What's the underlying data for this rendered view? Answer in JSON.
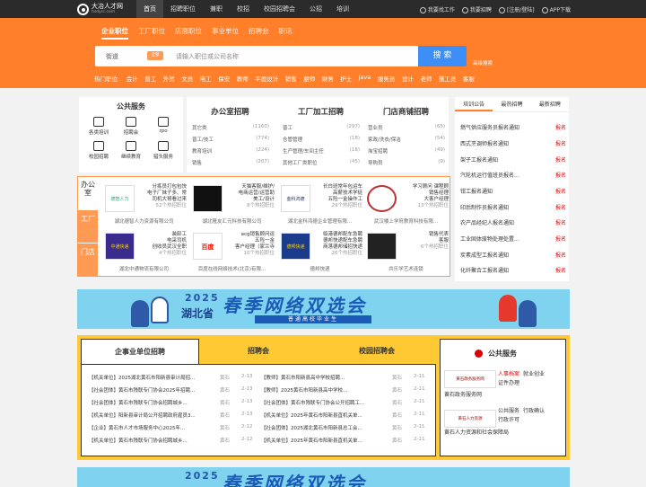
{
  "brand": {
    "name": "大冶人才网",
    "sub": "hsdyrc.com"
  },
  "topnav": [
    "首页",
    "招聘职位",
    "兼职",
    "校招",
    "校园招聘会",
    "公招",
    "培训"
  ],
  "topright": [
    "我要找工作",
    "我要招聘",
    "[注册/登陆]",
    "APP下载"
  ],
  "search": {
    "tabs": [
      "企业职位",
      "工厂职位",
      "店面职位",
      "事业单位",
      "招聘会",
      "职讯"
    ],
    "city": "街道",
    "tag": "全部",
    "placeholder": "请输入职位或公司名称",
    "button": "搜 索",
    "advanced": "高级搜索"
  },
  "hot": {
    "label": "热门职位:",
    "items": [
      "会计",
      "普工",
      "外贸",
      "文员",
      "电工",
      "保安",
      "教师",
      "平面设计",
      "销售",
      "厨师",
      "财务",
      "护士",
      "java",
      "服务员",
      "设计",
      "老师",
      "施工员",
      "客服"
    ]
  },
  "services": {
    "title": "公共服务",
    "items": [
      "各类培训",
      "招聘会",
      "rpo",
      "校园招聘",
      "继续教育",
      "猎头服务"
    ]
  },
  "categories": [
    {
      "title": "办公室招聘",
      "rows": [
        [
          "其它类",
          "(1160)"
        ],
        [
          "普工/技工",
          "(774)"
        ],
        [
          "教育培训",
          "(224)"
        ],
        [
          "销售",
          "(207)"
        ]
      ]
    },
    {
      "title": "工厂加工招聘",
      "rows": [
        [
          "普工",
          "(297)"
        ],
        [
          "仓管管理",
          "(18)"
        ],
        [
          "生产管理/车间主任",
          "(18)"
        ],
        [
          "其他工厂类职位",
          "(45)"
        ]
      ]
    },
    {
      "title": "门店商铺招聘",
      "rows": [
        [
          "营业员",
          "(65)"
        ],
        [
          "家政/洗衣/保洁",
          "(54)"
        ],
        [
          "淘宝招聘",
          "(49)"
        ],
        [
          "导购员",
          "(9)"
        ]
      ]
    }
  ],
  "notice": {
    "tabs": [
      "培训公告",
      "最热招聘",
      "最新招聘"
    ],
    "rows": [
      [
        "燃气供应服务员报名通知",
        "报名"
      ],
      [
        "西式烹调师报名通知",
        "报名"
      ],
      [
        "架子工报名通知",
        "报名"
      ],
      [
        "汽轮机运行值班员报名...",
        "报名"
      ],
      [
        "钳工报名通知",
        "报名"
      ],
      [
        "印后制作员报名通知",
        "报名"
      ],
      [
        "农产品经纪人报名通知",
        "报名"
      ],
      [
        "工业固体废物处理处置...",
        "报名"
      ],
      [
        "炭素成型工报名通知",
        "报名"
      ],
      [
        "化纤聚合工报名通知",
        "报名"
      ]
    ]
  },
  "jobs": {
    "side": [
      "办公室",
      "工厂",
      "门店"
    ],
    "cells": [
      {
        "lines": [
          "分拣员打包包快",
          "电子厂妹子多、常",
          "司机大哥看过来"
        ],
        "sub": "52个热招职位",
        "company": "湖北德智人力资源有限公司",
        "logo": "德智人力"
      },
      {
        "lines": [
          "天猫客服/维护/",
          "电商运营/运营助",
          "美工/设计"
        ],
        "sub": "8个热招职位",
        "company": "湖北隆友汇元科技有限公司",
        "logo": ""
      },
      {
        "lines": [
          "长白班常年包运车",
          "高薪技术学徒",
          "五险一金操作工"
        ],
        "sub": "29个热招职位",
        "company": "湖北金科鸿德企业管理有限...",
        "logo": "金科鸿德"
      },
      {
        "lines": [
          "学习顾问 课程顾",
          "销售经理",
          "大客户经理"
        ],
        "sub": "13个热招职位",
        "company": "武汉楼上学府教育科技有限...",
        "logo": ""
      },
      {
        "lines": [
          "装卸工",
          "电采司机",
          "创收员武汉全职",
          "4个热招职位"
        ],
        "sub": "",
        "company": "湖北中通物流有限公司",
        "logo": "中通快递"
      },
      {
        "lines": [
          "acg销售顾问运",
          "五险一金",
          "客户经理（家兰寺"
        ],
        "sub": "10个热招职位",
        "company": "百度在线网络技术(北京)有限...",
        "logo": "百度"
      },
      {
        "lines": [
          "临港德邦配车急聘",
          "德邦快递配车急聘",
          "商落德邦储招快递"
        ],
        "sub": "26个热招职位",
        "company": "德邦快递",
        "logo": "德邦快递"
      },
      {
        "lines": [
          "销售代表",
          "客服"
        ],
        "sub": "6个热招职位",
        "company": "共乐学艺术连锁",
        "logo": ""
      }
    ]
  },
  "banner": {
    "year": "2025",
    "main": "春季网络双选会",
    "prov": "湖北省",
    "sub": "普通高校毕业生"
  },
  "bottom": {
    "tabs": [
      "企事业单位招聘",
      "招聘会",
      "校园招聘会"
    ],
    "left": [
      [
        "【机关单位】2025湖北黄石市阳新县审计局招...",
        "黄石",
        "2-13"
      ],
      [
        "【社会团体】黄石市残联专门协会2025年招聘...",
        "黄石",
        "2-13"
      ],
      [
        "【社会团体】黄石市残联专门协会招聘城乡...",
        "黄石",
        "2-13"
      ],
      [
        "【机关单位】阳新县审计局公开招聘政府雇员3...",
        "黄石",
        "2-13"
      ],
      [
        "【企业】黄石市人才市场服务中心2025年...",
        "黄石",
        "2-12"
      ],
      [
        "【机关单位】黄石市残联专门协会招聘城乡...",
        "黄石",
        "2-12"
      ]
    ],
    "right": [
      [
        "【教师】黄石市阳新县高中学校招聘...",
        "黄石",
        "2-11"
      ],
      [
        "【教师】2025黄石市阳新县高中学校...",
        "黄石",
        "2-11"
      ],
      [
        "【社会团体】黄石市残联专门协会公开招聘工...",
        "黄石",
        "2-11"
      ],
      [
        "【机关单位】2025年黄石市阳新县直机关单...",
        "黄石",
        "2-11"
      ],
      [
        "【社会团体】2025湖北黄石市阳新县总工会...",
        "黄石",
        "2-11"
      ],
      [
        "【机关单位】2025年黄石市阳新县直机关单...",
        "黄石",
        "2-11"
      ]
    ],
    "service": {
      "title": "公共服务",
      "box1": {
        "name": "黄石政务服务网",
        "links": [
          "人事档案",
          "就业创业",
          "证件办理"
        ]
      },
      "box2": {
        "name": "黄石人力资源和社会保障局",
        "links": [
          "公共服务",
          "行政确认",
          "行政许可"
        ]
      }
    }
  }
}
